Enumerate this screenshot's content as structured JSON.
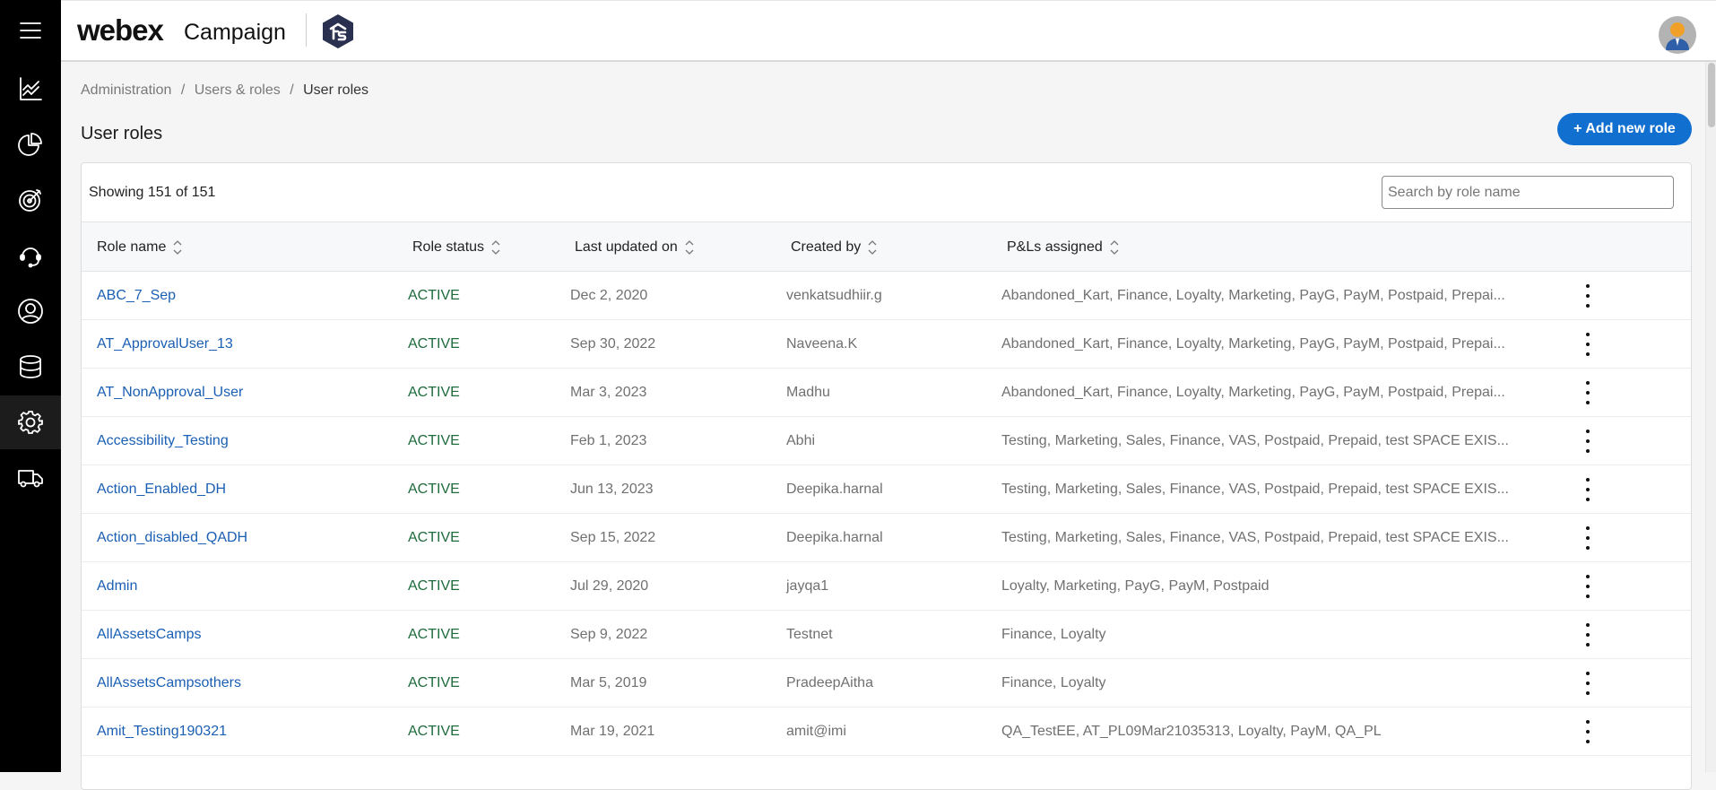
{
  "app": {
    "brand": "webex",
    "product": "Campaign",
    "logo_icon": "ts-hexagon-logo",
    "avatar_icon": "user-avatar"
  },
  "sidebar": {
    "items": [
      {
        "id": "menu",
        "icon": "hamburger-menu-icon",
        "active": false
      },
      {
        "id": "analytics",
        "icon": "line-chart-icon",
        "active": false
      },
      {
        "id": "reports",
        "icon": "pie-chart-icon",
        "active": false
      },
      {
        "id": "campaigns",
        "icon": "target-icon",
        "active": false
      },
      {
        "id": "support",
        "icon": "headset-icon",
        "active": false
      },
      {
        "id": "contacts",
        "icon": "user-circle-icon",
        "active": false
      },
      {
        "id": "data",
        "icon": "database-icon",
        "active": false
      },
      {
        "id": "settings",
        "icon": "gear-icon",
        "active": true
      },
      {
        "id": "delivery",
        "icon": "truck-icon",
        "active": false
      }
    ]
  },
  "breadcrumb": {
    "items": [
      "Administration",
      "Users & roles",
      "User roles"
    ],
    "separator": "/"
  },
  "page": {
    "title": "User roles",
    "add_button": "+ Add new role"
  },
  "colors": {
    "accent": "#1170cf",
    "link": "#1a5fb4",
    "status_active": "#1e6b3c",
    "sidebar_bg": "#000000"
  },
  "table": {
    "showing": "Showing 151 of 151",
    "search_placeholder": "Search by role name",
    "search_value": "",
    "columns": [
      "Role name",
      "Role status",
      "Last updated on",
      "Created by",
      "P&Ls assigned"
    ],
    "rows": [
      {
        "name": "ABC_7_Sep",
        "status": "ACTIVE",
        "updated": "Dec 2, 2020",
        "created_by": "venkatsudhiir.g",
        "pls": "Abandoned_Kart, Finance, Loyalty, Marketing, PayG, PayM, Postpaid, Prepai..."
      },
      {
        "name": "AT_ApprovalUser_13",
        "status": "ACTIVE",
        "updated": "Sep 30, 2022",
        "created_by": "Naveena.K",
        "pls": "Abandoned_Kart, Finance, Loyalty, Marketing, PayG, PayM, Postpaid, Prepai..."
      },
      {
        "name": "AT_NonApproval_User",
        "status": "ACTIVE",
        "updated": "Mar 3, 2023",
        "created_by": "Madhu",
        "pls": "Abandoned_Kart, Finance, Loyalty, Marketing, PayG, PayM, Postpaid, Prepai..."
      },
      {
        "name": "Accessibility_Testing",
        "status": "ACTIVE",
        "updated": "Feb 1, 2023",
        "created_by": "Abhi",
        "pls": "Testing, Marketing, Sales, Finance, VAS, Postpaid, Prepaid, test SPACE EXIS..."
      },
      {
        "name": "Action_Enabled_DH",
        "status": "ACTIVE",
        "updated": "Jun 13, 2023",
        "created_by": "Deepika.harnal",
        "pls": "Testing, Marketing, Sales, Finance, VAS, Postpaid, Prepaid, test SPACE EXIS..."
      },
      {
        "name": "Action_disabled_QADH",
        "status": "ACTIVE",
        "updated": "Sep 15, 2022",
        "created_by": "Deepika.harnal",
        "pls": "Testing, Marketing, Sales, Finance, VAS, Postpaid, Prepaid, test SPACE EXIS..."
      },
      {
        "name": "Admin",
        "status": "ACTIVE",
        "updated": "Jul 29, 2020",
        "created_by": "jayqa1",
        "pls": "Loyalty, Marketing, PayG, PayM, Postpaid"
      },
      {
        "name": "AllAssetsCamps",
        "status": "ACTIVE",
        "updated": "Sep 9, 2022",
        "created_by": "Testnet",
        "pls": "Finance, Loyalty"
      },
      {
        "name": "AllAssetsCampsothers",
        "status": "ACTIVE",
        "updated": "Mar 5, 2019",
        "created_by": "PradeepAitha",
        "pls": "Finance, Loyalty"
      },
      {
        "name": "Amit_Testing190321",
        "status": "ACTIVE",
        "updated": "Mar 19, 2021",
        "created_by": "amit@imi",
        "pls": "QA_TestEE, AT_PL09Mar21035313, Loyalty, PayM, QA_PL"
      }
    ]
  }
}
